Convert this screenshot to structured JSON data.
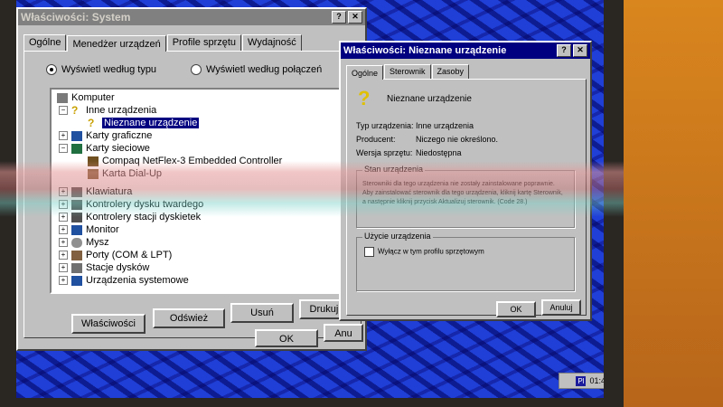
{
  "system_window": {
    "title": "Właściwości: System",
    "tabs": [
      "Ogólne",
      "Menedżer urządzeń",
      "Profile sprzętu",
      "Wydajność"
    ],
    "view_by_type": "Wyświetl według typu",
    "view_by_connection": "Wyświetl według połączeń",
    "tree": [
      "Komputer",
      "Inne urządzenia",
      "Nieznane urządzenie",
      "Karty graficzne",
      "Karty sieciowe",
      "Compaq NetFlex-3 Embedded Controller",
      "Karta Dial-Up",
      "Klawiatura",
      "Kontrolery dysku twardego",
      "Kontrolery stacji dyskietek",
      "Monitor",
      "Mysz",
      "Porty (COM & LPT)",
      "Stacje dysków",
      "Urządzenia systemowe"
    ],
    "buttons": {
      "properties": "Właściwości",
      "refresh": "Odśwież",
      "remove": "Usuń",
      "print": "Drukuj...",
      "ok": "OK",
      "cancel": "Anu"
    }
  },
  "device_window": {
    "title": "Właściwości: Nieznane urządzenie",
    "tabs": [
      "Ogólne",
      "Sterownik",
      "Zasoby"
    ],
    "device_name": "Nieznane urządzenie",
    "fields": [
      {
        "label": "Typ urządzenia:",
        "value": "Inne urządzenia"
      },
      {
        "label": "Producent:",
        "value": "Niczego nie określono."
      },
      {
        "label": "Wersja sprzętu:",
        "value": "Niedostępna"
      }
    ],
    "status_group": "Stan urządzenia",
    "status_text": "Sterowniki dla tego urządzenia nie zostały zainstalowane poprawnie. Aby zainstalować sterownik dla tego urządzenia, kliknij kartę Sterownik, a następnie kliknij przycisk Aktualizuj sterownik. (Code 28.)",
    "usage_group": "Użycie urządzenia",
    "disable_checkbox": "Wyłącz w tym profilu sprzętowym",
    "buttons": {
      "ok": "OK",
      "cancel": "Anuluj"
    }
  },
  "taskbar": {
    "clock": "01:46",
    "tray_icon": "Pl"
  },
  "colors": {
    "titlebar_active": "#000080",
    "desktop": "#1f3fd6",
    "wall": "#c8741c"
  }
}
